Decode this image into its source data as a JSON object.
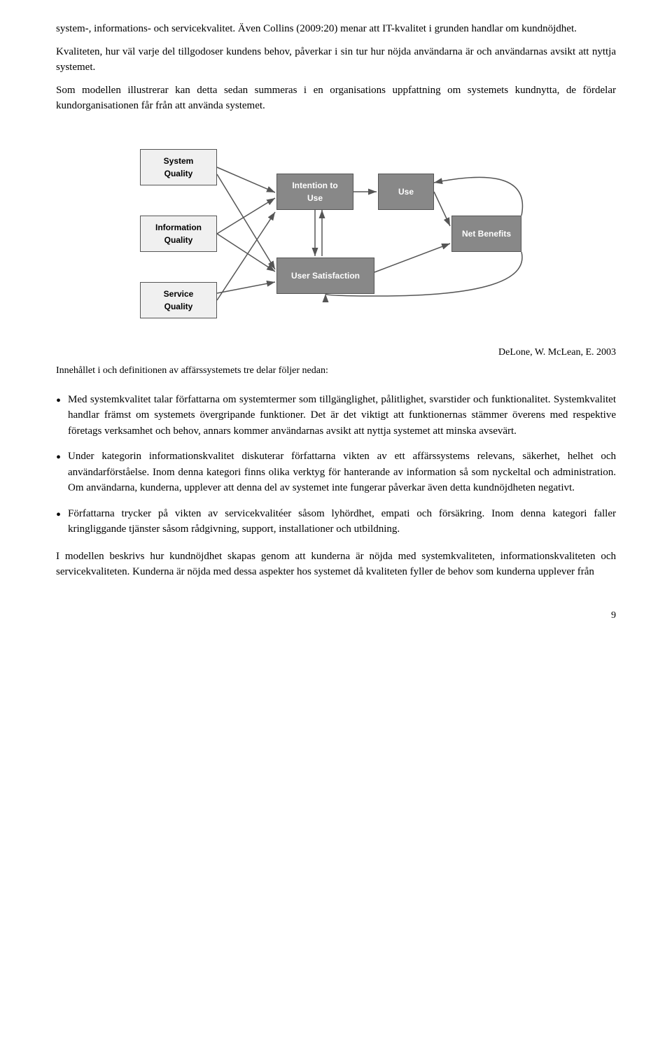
{
  "paragraphs": {
    "p1": "system-, informations- och servicekvalitet. Även Collins (2009:20) menar att IT-kvalitet i grunden handlar om kundnöjdhet.",
    "p2": "Kvaliteten, hur väl varje del tillgodoser kundens behov, påverkar i sin tur hur nöjda användarna är och användarnas avsikt att nyttja systemet.",
    "p3": "Som modellen illustrerar kan detta sedan summeras i en organisations uppfattning om systemets kundnytta, de fördelar kundorganisationen får från att använda systemet.",
    "citation": "DeLone, W. McLean, E. 2003",
    "caption": "Innehållet i och definitionen av affärssystemets tre delar följer nedan:",
    "bullet1": "Med systemkvalitet talar författarna om systemtermer som tillgänglighet, pålitlighet, svarstider och funktionalitet. Systemkvalitet handlar främst om systemets övergripande funktioner. Det är det viktigt att funktionernas stämmer överens med respektive företags verksamhet och behov, annars kommer användarnas avsikt att nyttja systemet att minska avsevärt.",
    "bullet2": "Under kategorin informationskvalitet diskuterar författarna vikten av ett affärssystems relevans, säkerhet, helhet och användarförståelse. Inom denna kategori finns olika verktyg för hanterande av information så som nyckeltal och administration. Om användarna, kunderna, upplever att denna del av systemet inte fungerar påverkar även detta kundnöjdheten negativt.",
    "bullet3": "Författarna trycker på vikten av servicekvalitéer såsom lyhördhet, empati och försäkring. Inom denna kategori faller kringliggande tjänster såsom rådgivning, support, installationer och utbildning.",
    "final_para": "I modellen beskrivs hur kundnöjdhet skapas genom att kunderna är nöjda med systemkvaliteten, informationskvaliteten och servicekvaliteten. Kunderna är nöjda med dessa aspekter hos systemet då kvaliteten fyller de behov som kunderna upplever från",
    "page_num": "9",
    "diagram": {
      "boxes": [
        {
          "id": "system-quality",
          "label": "System\nQuality",
          "dark": false
        },
        {
          "id": "information-quality",
          "label": "Information\nQuality",
          "dark": false
        },
        {
          "id": "service-quality",
          "label": "Service\nQuality",
          "dark": false
        },
        {
          "id": "intention-to-use",
          "label": "Intention to\nUse",
          "dark": true
        },
        {
          "id": "use",
          "label": "Use",
          "dark": true
        },
        {
          "id": "user-satisfaction",
          "label": "User Satisfaction",
          "dark": true
        },
        {
          "id": "net-benefits",
          "label": "Net Benefits",
          "dark": true
        }
      ]
    }
  }
}
